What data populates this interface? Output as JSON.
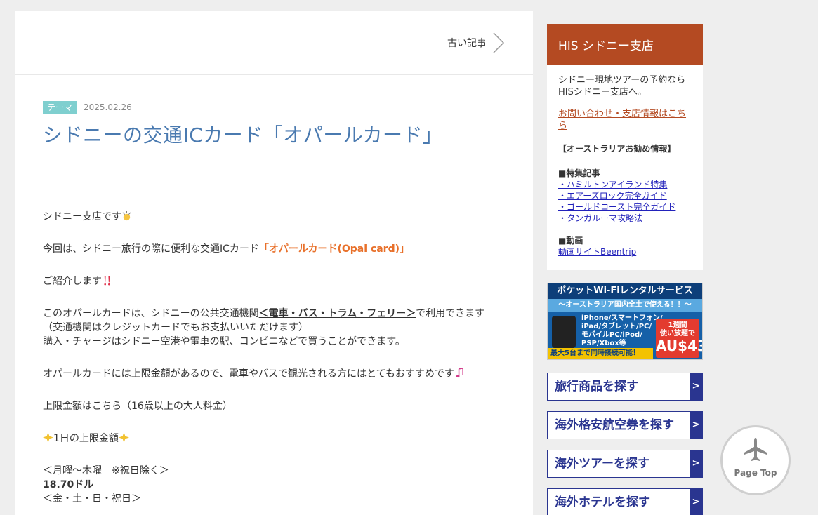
{
  "nav": {
    "older_label": "古い記事"
  },
  "article": {
    "tag": "テーマ",
    "date": "2025.02.26",
    "title": "シドニーの交通ICカード「オパールカード」",
    "p1": "シドニー支店です",
    "p2_prefix": "今回は、シドニー旅行の際に便利な交通ICカード",
    "p2_highlight": "「オパールカード(Opal card)」",
    "p3": "ご紹介します",
    "p4_prefix": "このオパールカードは、シドニーの公共交通機関",
    "p4_link": "＜電車・バス・トラム・フェリー＞",
    "p4_suffix": "で利用できます",
    "p4_line2": "（交通機関はクレジットカードでもお支払いいただけます）",
    "p4_line3": "購入・チャージはシドニー空港や電車の駅、コンビニなどで買うことができます。",
    "p5": "オパールカードには上限金額があるので、電車やバスで観光される方にはとてもおすすめです",
    "p6": "上限金額はこちら（16歳以上の大人料金）",
    "p7": "1日の上限金額",
    "p8_line1": "＜月曜～木曜　※祝日除く＞",
    "p8_line2": "18.70ドル",
    "p8_line3": "＜金・土・日・祝日＞"
  },
  "sidebar": {
    "his_title": "HIS シドニー支店",
    "his_desc": "シドニー現地ツアーの予約ならHISシドニー支店へ。",
    "contact": "お問い合わせ・支店情報はこちら",
    "recommend": "【オーストラリアお勧め情報】",
    "featured_heading": "■特集記事",
    "featured": [
      "・ハミルトンアイランド特集",
      "・エアーズロック完全ガイド",
      "・ゴールドコースト完全ガイド",
      "・タンガルーマ攻略法"
    ],
    "video_heading": "■動画",
    "video_link": "動画サイトBeentrip",
    "banner": {
      "title": "ポケットWi-Fiレンタルサービス",
      "subtitle": "～オーストラリア国内全土で使える！！～",
      "devices": [
        "iPhone/スマートフォン/",
        "iPad/タブレット/PC/",
        "モバイルPC/iPod/",
        "PSP/Xbox等"
      ],
      "price_line1": "1週間",
      "price_line2": "使い放題で",
      "price": "AU$43",
      "bottom": "最大5台まで同時接続可能！"
    },
    "buttons": [
      {
        "label": "旅行商品を探す",
        "arrow": ">"
      },
      {
        "label": "海外格安航空券を探す",
        "arrow": ">"
      },
      {
        "label": "海外ツアーを探す",
        "arrow": ">"
      },
      {
        "label": "海外ホテルを探す",
        "arrow": ">"
      }
    ]
  },
  "page_top": {
    "label": "Page Top"
  }
}
